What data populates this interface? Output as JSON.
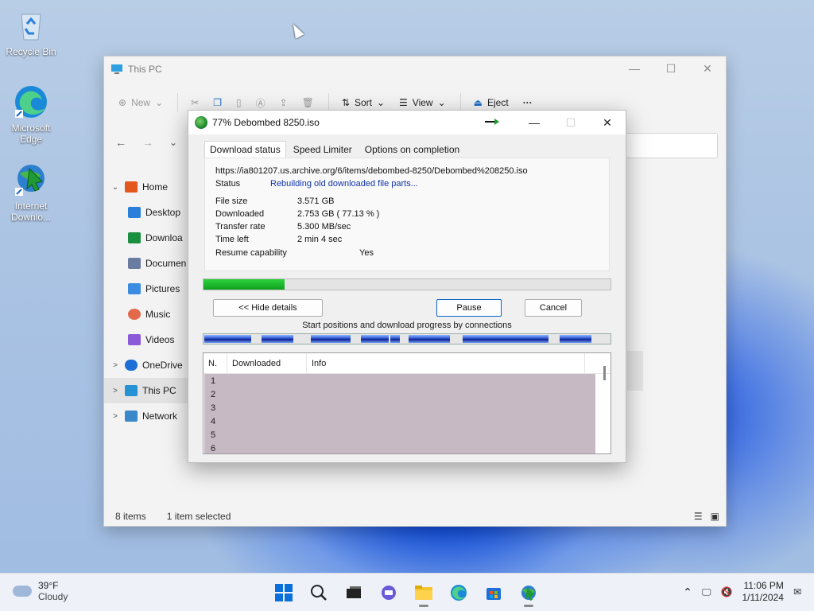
{
  "desktop": {
    "icons": [
      {
        "label": "Recycle Bin"
      },
      {
        "label": "Microsoft Edge"
      },
      {
        "label": "Internet Downlo..."
      }
    ]
  },
  "explorer": {
    "title": "This PC",
    "toolbar": {
      "new": "New",
      "sort": "Sort",
      "view": "View",
      "eject": "Eject",
      "more": "···"
    },
    "sidebar": [
      {
        "label": "Home",
        "chev": "⌄",
        "icon": "home-icon",
        "color": "#e4571c"
      },
      {
        "label": "Desktop",
        "icon": "desktop-icon",
        "color": "#2a7fd8"
      },
      {
        "label": "Downloa",
        "icon": "download-icon",
        "color": "#1a8f3f"
      },
      {
        "label": "Documen",
        "icon": "document-icon",
        "color": "#6a7da1"
      },
      {
        "label": "Pictures",
        "icon": "pictures-icon",
        "color": "#3a8de0"
      },
      {
        "label": "Music",
        "icon": "music-icon",
        "color": "#e26a4a"
      },
      {
        "label": "Videos",
        "icon": "videos-icon",
        "color": "#8b5ad8"
      },
      {
        "label": "OneDrive",
        "chev": ">",
        "icon": "onedrive-icon",
        "color": "#1b6fd6"
      },
      {
        "label": "This PC",
        "chev": ">",
        "icon": "pc-icon",
        "color": "#2592d6"
      },
      {
        "label": "Network",
        "chev": ">",
        "icon": "network-icon",
        "color": "#3a88c9"
      }
    ],
    "status": {
      "items": "8 items",
      "selected": "1 item selected"
    }
  },
  "idm": {
    "title": "77% Debombed 8250.iso",
    "tabs": [
      "Download status",
      "Speed Limiter",
      "Options on completion"
    ],
    "url": "https://ia801207.us.archive.org/6/items/debombed-8250/Debombed%208250.iso",
    "status_label": "Status",
    "status_value": "Rebuilding old downloaded file parts...",
    "rows": [
      {
        "k": "File size",
        "v": "3.571  GB"
      },
      {
        "k": "Downloaded",
        "v": "2.753  GB  ( 77.13 % )"
      },
      {
        "k": "Transfer rate",
        "v": "5.300  MB/sec"
      },
      {
        "k": "Time left",
        "v": "2 min 4 sec"
      },
      {
        "k": "Resume capability",
        "v": "Yes"
      }
    ],
    "progress_fraction": 0.2,
    "buttons": {
      "hide": "<< Hide details",
      "pause": "Pause",
      "cancel": "Cancel"
    },
    "conn_label": "Start positions and download progress by connections",
    "conn_table": {
      "headers": [
        "N.",
        "Downloaded",
        "Info"
      ],
      "rows": [
        "1",
        "2",
        "3",
        "4",
        "5",
        "6"
      ]
    }
  },
  "taskbar": {
    "weather": {
      "temp": "39°F",
      "cond": "Cloudy"
    },
    "clock": {
      "time": "11:06 PM",
      "date": "1/11/2024"
    },
    "tray_up": "⌃"
  }
}
